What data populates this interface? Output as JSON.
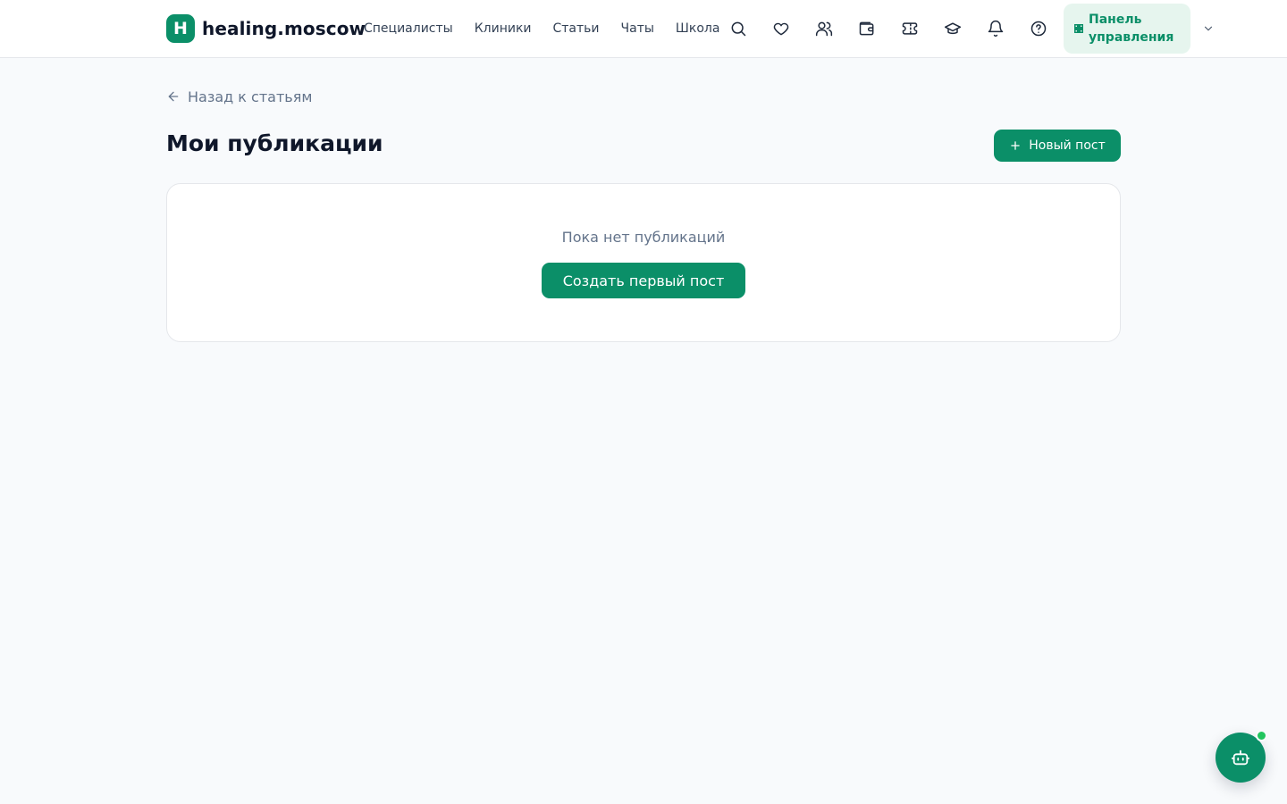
{
  "header": {
    "logo_letter": "H",
    "logo_text": "healing.moscow",
    "nav": [
      "Специалисты",
      "Клиники",
      "Статьи",
      "Чаты",
      "Школа"
    ],
    "icons": [
      "search-icon",
      "heart-icon",
      "users-icon",
      "wallet-icon",
      "ticket-icon",
      "graduation-cap-icon",
      "bell-icon",
      "help-circle-icon"
    ],
    "panel_label": "Панель управления",
    "panel_icon": "grid-icon",
    "menu_icon": "chevron-down-icon"
  },
  "main": {
    "back_label": "Назад к статьям",
    "title": "Мои публикации",
    "new_post_label": "Новый пост",
    "empty_text": "Пока нет публикаций",
    "create_first_label": "Создать первый пост"
  },
  "assistant": {
    "icon": "bot-icon",
    "status_color": "#22c55e"
  },
  "colors": {
    "brand": "#0b8f68",
    "brand_light": "#e6f5ee",
    "background": "#f8fafc"
  }
}
